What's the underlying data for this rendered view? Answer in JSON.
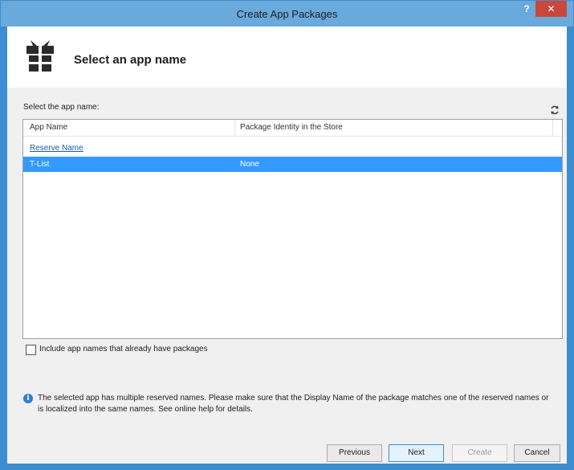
{
  "window": {
    "title": "Create App Packages",
    "help": "?",
    "close": "✕"
  },
  "header": {
    "title": "Select an app name",
    "icon": "gift-box-icon"
  },
  "main": {
    "select_label": "Select the app name:",
    "refresh_icon": "refresh-icon",
    "columns": [
      "App Name",
      "Package Identity in the Store"
    ],
    "rows": [
      {
        "app_name": "Reserve Name",
        "identity": ""
      },
      {
        "app_name": "T-List",
        "identity": "None"
      }
    ],
    "checkbox_label": "Include app names that already have packages",
    "info_text": "The selected app has multiple reserved names. Please make sure that the Display Name of the package matches one of the reserved names or is localized into the same names. See online help for details."
  },
  "buttons": {
    "previous": "Previous",
    "next": "Next",
    "create": "Create",
    "cancel": "Cancel"
  },
  "colors": {
    "titlebar": "#6aa9dc",
    "selection": "#3399ff",
    "close": "#c9483c",
    "link": "#1a5da6"
  }
}
